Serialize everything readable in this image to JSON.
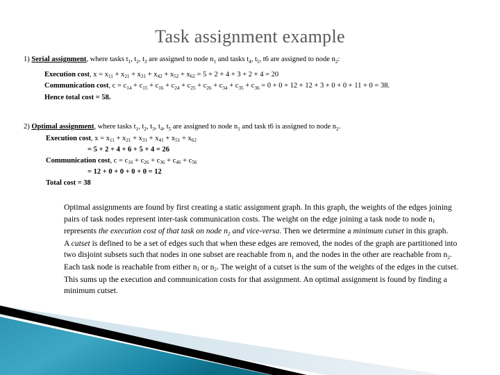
{
  "slide": {
    "title": "Task assignment example",
    "title_color": "#595959",
    "background_color": "#ffffff"
  },
  "sections": [
    {
      "number": "1)",
      "heading": "Serial assignment",
      "heading_rest": ", where tasks t",
      "intro_parts": {
        "a": ", where tasks t",
        "s1": "1",
        "b": ", t",
        "s2": "2",
        "c": ",  t",
        "s3": "3",
        "d": " are assigned to node n",
        "s4": "1",
        "e": " and tasks t",
        "s5": "4",
        "f": ", t",
        "s6": "5",
        "g": ", t6 are assigned to node n",
        "s7": "2",
        "h": ":"
      },
      "lines": [
        {
          "label": "Execution cost",
          "body": ", x = x11 + x21 + x31 + x42 + x52 + x62  = 5 + 2 + 4 + 3 + 2 + 4 = 20"
        },
        {
          "label": "Communication cost",
          "body": ", c = c14 + c15 + c16 + c24 + c25 + c26 + c34 + c35 + c36 = 0 + 0 + 12 + 12 + 3 + 0 + 0 + 11 + 0 = 38."
        },
        {
          "label": "Hence total cost = 58.",
          "body": ""
        }
      ]
    },
    {
      "number": "2)",
      "heading": "Optimal assignment",
      "lines": [
        {
          "label": "Execution cost",
          "body": ", x = x11 + x21 + x31 + x41 + x51 + x62"
        },
        {
          "label": "= 5 + 2 + 4 + 6 + 5 + 4 = 26",
          "body": ""
        },
        {
          "label": "Communication cost",
          "body": ", c = c16 + c26 + c36 + c46 + c56"
        },
        {
          "label": "= 12 + 0 + 0 + 0 + 0 = 12",
          "body": ""
        },
        {
          "label": "Total cost = 38",
          "body": ""
        }
      ]
    }
  ],
  "text": {
    "sec1_num": "1)",
    "sec1_heading": "Serial assignment",
    "sec1_rest_a": ", where tasks t",
    "sec1_sub1": "1",
    "sec1_rest_b": ", t",
    "sec1_sub2": "2",
    "sec1_rest_c": ",  t",
    "sec1_sub3": "3",
    "sec1_rest_d": " are assigned to node n",
    "sec1_sub4": "1",
    "sec1_rest_e": " and tasks t",
    "sec1_sub5": "4",
    "sec1_rest_f": ", t",
    "sec1_sub6": "5",
    "sec1_rest_g": ", t6 are assigned to node n",
    "sec1_sub7": "2",
    "sec1_rest_h": ":",
    "exec_label_1": "Execution cost",
    "exec_eq_1_pre": ", x = x",
    "exec_1_s1": "11",
    "exec_1_p1": " + x",
    "exec_1_s2": "21",
    "exec_1_p2": " + x",
    "exec_1_s3": "31",
    "exec_1_p3": " + x",
    "exec_1_s4": "42",
    "exec_1_p4": " + x",
    "exec_1_s5": "52",
    "exec_1_p5": " + x",
    "exec_1_s6": "62",
    "exec_1_tail": "  = 5 + 2 + 4 + 3 + 2 + 4 = 20",
    "comm_label_1": "Communication cost",
    "comm_1_pre": ", c = c",
    "comm_1_s1": "14",
    "comm_1_p1": " + c",
    "comm_1_s2": "15",
    "comm_1_p2": " + c",
    "comm_1_s3": "16",
    "comm_1_p3": " + c",
    "comm_1_s4": "24",
    "comm_1_p4": " + c",
    "comm_1_s5": "25",
    "comm_1_p5": " + c",
    "comm_1_s6": "26",
    "comm_1_p6": " + c",
    "comm_1_s7": "34",
    "comm_1_p7": " + c",
    "comm_1_s8": "35",
    "comm_1_p8": " + c",
    "comm_1_s9": "36",
    "comm_1_tail": " = 0 + 0 + 12 + 12 + 3 + 0 + 0 + 11 + 0 = 38.",
    "hence_total_1": "Hence total cost = 58.",
    "sec2_num": "2)",
    "sec2_heading": "Optimal assignment",
    "sec2_rest_a": ", where tasks t",
    "sec2_sub1": "1",
    "sec2_rest_b": ", t",
    "sec2_sub2": "2",
    "sec2_rest_c": ", t",
    "sec2_sub3": "3",
    "sec2_rest_d": ", t",
    "sec2_sub4": "4",
    "sec2_rest_e": ", t",
    "sec2_sub5": "5",
    "sec2_rest_f": " are assigned to node n",
    "sec2_sub6": "1",
    "sec2_rest_g": " and task t6 is assigned to node n",
    "sec2_sub7": "2",
    "sec2_rest_h": ".",
    "exec_label_2": "Execution cost",
    "exec_2_pre": ", x = x",
    "exec_2_s1": "11",
    "exec_2_p1": " + x",
    "exec_2_s2": "21",
    "exec_2_p2": " + x",
    "exec_2_s3": "31",
    "exec_2_p3": " + x",
    "exec_2_s4": "41",
    "exec_2_p4": " + x",
    "exec_2_s5": "51",
    "exec_2_p5": " + x",
    "exec_2_s6": "62",
    "exec_2_sum": "= 5 + 2 + 4 + 6 + 5 + 4 = 26",
    "comm_label_2": "Communication cost",
    "comm_2_pre": ", c = c",
    "comm_2_s1": "16",
    "comm_2_p1": " + c",
    "comm_2_s2": "26",
    "comm_2_p2": " + c",
    "comm_2_s3": "36",
    "comm_2_p3": " + c",
    "comm_2_s4": "46",
    "comm_2_p4": " + c",
    "comm_2_s5": "56",
    "comm_2_sum": "= 12 + 0 + 0 + 0 + 0 = 12",
    "total_cost_2": "Total cost = 38",
    "p1_a": "Optimal assignments are found by first creating a static assignment graph. In this graph, the weights of the edges joining pairs of task nodes represent inter-task communication costs. The weight on the edge joining a task node to node n",
    "p1_sub1": "1",
    "p1_b": " represents ",
    "p1_ital1": "the execution cost of that task on node n",
    "p1_ital_sub": "2",
    "p1_ital2": " and vice-versa",
    "p1_c": ". Then we determine a ",
    "p1_ital3": "minimum cutset",
    "p1_d": " in this graph.",
    "p2_a": " A ",
    "p2_ital1": "cutset",
    "p2_b": " is defined to be a set of edges such that when these edges are removed, the nodes of the graph are partitioned into two disjoint subsets such that nodes in one subset are reachable from n",
    "p2_sub1": "1",
    "p2_c": " and the nodes in the other are reachable from n",
    "p2_sub2": "2",
    "p2_d": ". Each task node is reachable from either n",
    "p2_sub3": "1",
    "p2_e": " or n",
    "p2_sub4": "2",
    "p2_f": ". The weight of a cutset is the sum of the weights of the edges in the cutset. This sums up the execution and communication costs for that assignment.  An optimal assignment is found by finding a minimum cutset."
  },
  "decoration": {
    "name": "bottom-left-diagonal-banner",
    "teal_light": "#3ea8c4",
    "teal_dark": "#0d7c96",
    "black": "#000000",
    "pale_blue": "#dbe8ef"
  }
}
